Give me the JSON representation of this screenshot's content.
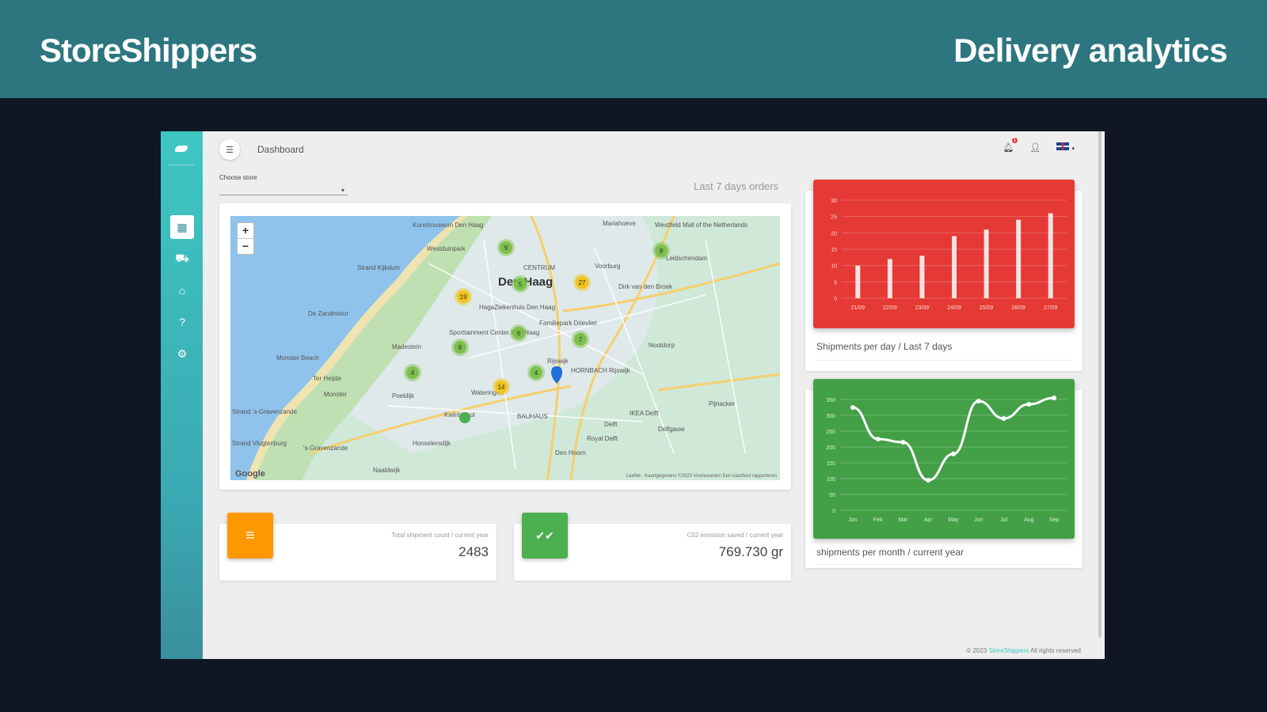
{
  "slide": {
    "brand": "StoreShippers",
    "title": "Delivery analytics"
  },
  "app": {
    "breadcrumb": "Dashboard",
    "notification_count": "1",
    "sidebar": [
      {
        "name": "dashboard",
        "icon": "dashboard-icon",
        "glyph": "▦",
        "active": true
      },
      {
        "name": "shipments",
        "icon": "truck-icon",
        "glyph": "⛟",
        "active": false
      },
      {
        "name": "stores",
        "icon": "home-icon",
        "glyph": "⌂",
        "active": false
      },
      {
        "name": "help",
        "icon": "help-icon",
        "glyph": "?",
        "active": false
      },
      {
        "name": "settings",
        "icon": "gear-icon",
        "glyph": "⚙",
        "active": false
      }
    ],
    "store_select": {
      "label": "Choose store",
      "value": ""
    },
    "orders_title": "Last 7 days orders",
    "map": {
      "zoom_in": "+",
      "zoom_out": "−",
      "attribution": "Kaartgegevens ©2023   Voorwaarden   Een kaartfout rapporteren",
      "google": "Google",
      "leaflet": "Leaflet",
      "city_label": "Den Haag",
      "places": [
        "Kunstmuseum Den Haag",
        "Westfield Mall of the Netherlands",
        "Mariahoeve",
        "Westduinpark",
        "Voorburg",
        "Leidschendam",
        "CENTRUM",
        "Strand Kijkduin",
        "HagaZiekenhuis Den Haag",
        "Dirk van den Broek",
        "De Zandmotor",
        "Familiepark Drievliet",
        "Sporttainment Center Den Haag",
        "Madestein",
        "Nootdorp",
        "Monster Beach",
        "Rijswijk",
        "Ter Heijde",
        "Monster",
        "Poeldijk",
        "Wateringen",
        "HORNBACH Rijswijk",
        "Pijnacker",
        "Strand 's-Gravenzande",
        "Kwintsheul",
        "BAUHAUS",
        "IKEA Delft",
        "Delft",
        "Delfgauw",
        "'s-Gravenzande",
        "Honselersdijk",
        "Royal Delft",
        "Den Hoorn",
        "Naaldwijk",
        "Strand Vlugtenburg"
      ],
      "clusters": [
        {
          "label": "9",
          "color": "#7cbf4b"
        },
        {
          "label": "8",
          "color": "#7cbf4b"
        },
        {
          "label": "19",
          "color": "#f0c419"
        },
        {
          "label": "5",
          "color": "#7cbf4b"
        },
        {
          "label": "27",
          "color": "#f0c419"
        },
        {
          "label": "6",
          "color": "#7cbf4b"
        },
        {
          "label": "8",
          "color": "#7cbf4b"
        },
        {
          "label": "7",
          "color": "#7cbf4b"
        },
        {
          "label": "4",
          "color": "#7cbf4b"
        },
        {
          "label": "4",
          "color": "#7cbf4b"
        },
        {
          "label": "14",
          "color": "#f0c419"
        }
      ]
    },
    "stats": [
      {
        "label": "Total shipment count / current year",
        "value": "2483",
        "icon": "list-icon",
        "glyph": "≡",
        "color": "#ff9800"
      },
      {
        "label": "C02 emission saved / current year",
        "value": "769.730 gr",
        "icon": "double-check-icon",
        "glyph": "✔✔",
        "color": "#4caf50"
      }
    ],
    "footer": {
      "copy": "© 2023",
      "link": "StoreShippers",
      "rights": "All rights reserved"
    }
  },
  "chart_data": [
    {
      "type": "bar",
      "color": "#e53935",
      "categories": [
        "21/09",
        "22/09",
        "23/09",
        "24/09",
        "25/09",
        "26/09",
        "27/09"
      ],
      "values": [
        10,
        12,
        13,
        19,
        21,
        24,
        26
      ],
      "ylim": [
        0,
        30
      ],
      "yticks": [
        "0",
        "5",
        "10",
        "15",
        "20",
        "25",
        "30"
      ],
      "caption": "Shipments per day / Last 7 days"
    },
    {
      "type": "line",
      "color": "#43a047",
      "categories": [
        "Jan",
        "Feb",
        "Mar",
        "Apr",
        "May",
        "Jun",
        "Jul",
        "Aug",
        "Sep"
      ],
      "values": [
        325,
        225,
        215,
        95,
        178,
        345,
        290,
        335,
        355
      ],
      "ylim": [
        0,
        350
      ],
      "yticks": [
        "0",
        "50",
        "100",
        "150",
        "200",
        "250",
        "300",
        "350"
      ],
      "caption": "shipments per month / current year"
    }
  ]
}
